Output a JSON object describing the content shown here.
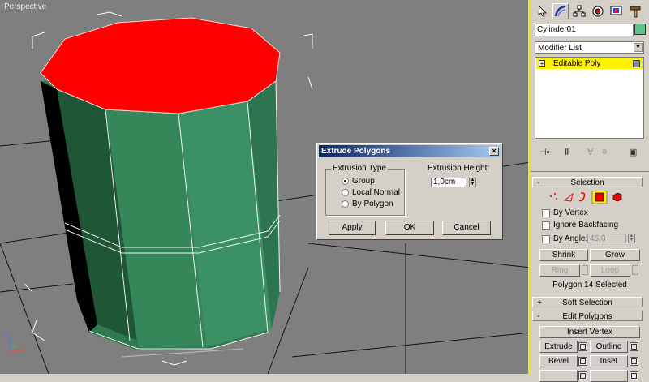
{
  "viewport": {
    "label": "Perspective"
  },
  "panel": {
    "toolbar_icons": [
      "select-cursor-icon",
      "modify-arc-icon",
      "hierarchy-icon",
      "motion-icon",
      "display-icon",
      "utilities-hammer-icon"
    ],
    "object_name": "Cylinder01",
    "object_color": "#5dc38a",
    "modifier_list_label": "Modifier List",
    "stack_items": [
      {
        "label": "Editable Poly",
        "highlight": "#fff200"
      }
    ],
    "selection": {
      "title": "Selection",
      "collapse_sign": "-",
      "by_vertex": "By Vertex",
      "ignore_backfacing": "Ignore Backfacing",
      "by_angle": "By Angle:",
      "angle_value": "45,0",
      "shrink": "Shrink",
      "grow": "Grow",
      "ring": "Ring",
      "loop": "Loop",
      "status": "Polygon 14 Selected"
    },
    "soft_selection": {
      "title": "Soft Selection",
      "sign": "+"
    },
    "edit_polygons": {
      "title": "Edit Polygons",
      "sign": "-",
      "insert_vertex": "Insert Vertex",
      "extrude": "Extrude",
      "outline": "Outline",
      "bevel": "Bevel",
      "inset": "Inset"
    }
  },
  "dialog": {
    "title": "Extrude Polygons",
    "close": "×",
    "extrusion_type_label": "Extrusion Type",
    "options": [
      "Group",
      "Local Normal",
      "By Polygon"
    ],
    "selected_option": "Group",
    "extrusion_height_label": "Extrusion Height:",
    "extrusion_height_value": "1,0cm",
    "apply": "Apply",
    "ok": "OK",
    "cancel": "Cancel"
  },
  "colors": {
    "viewport_bg": "#7f7f7f",
    "cylinder_top": "#ff0000",
    "cylinder_side": "#2e7d4f",
    "active_border": "#f2e500"
  }
}
